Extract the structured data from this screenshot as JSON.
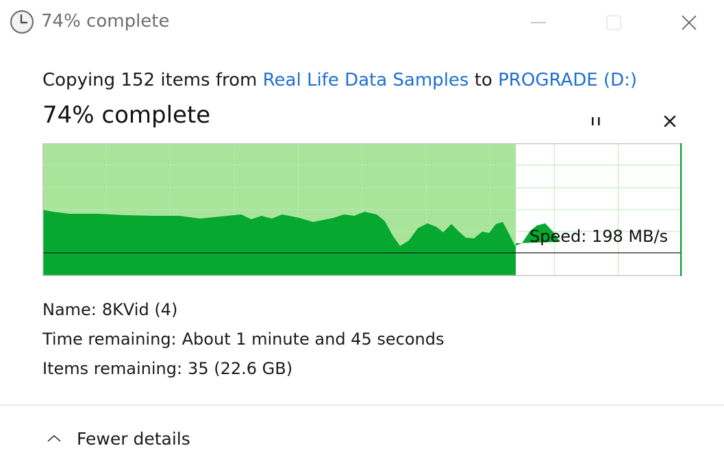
{
  "window": {
    "title": "74% complete",
    "controls": {
      "minimize": "minimize-icon",
      "maximize": "maximize-icon",
      "close": "close-icon"
    }
  },
  "header": {
    "copy_prefix": "Copying 152 items from ",
    "source": "Real Life Data Samples",
    "copy_middle": " to ",
    "destination": "PROGRADE (D:)",
    "progress_text": "74% complete"
  },
  "progress": {
    "percent": 74,
    "speed_label": "Speed: 198 MB/s",
    "speed_mbps": 198,
    "fill_color": "#a8e59a",
    "throughput_color": "#06a830",
    "grid_color": "#b8eab3"
  },
  "details": {
    "name_label": "Name:",
    "name_value": "8KVid (4)",
    "time_label": "Time remaining:",
    "time_value": "About 1 minute and 45 seconds",
    "items_label": "Items remaining:",
    "items_value": "35 (22.6 GB)"
  },
  "footer": {
    "toggle_label": "Fewer details",
    "toggle_icon": "chevron-up-icon"
  },
  "colors": {
    "link": "#1e6fd0",
    "title_text": "#6e6e6e",
    "background": "#ffffff"
  }
}
